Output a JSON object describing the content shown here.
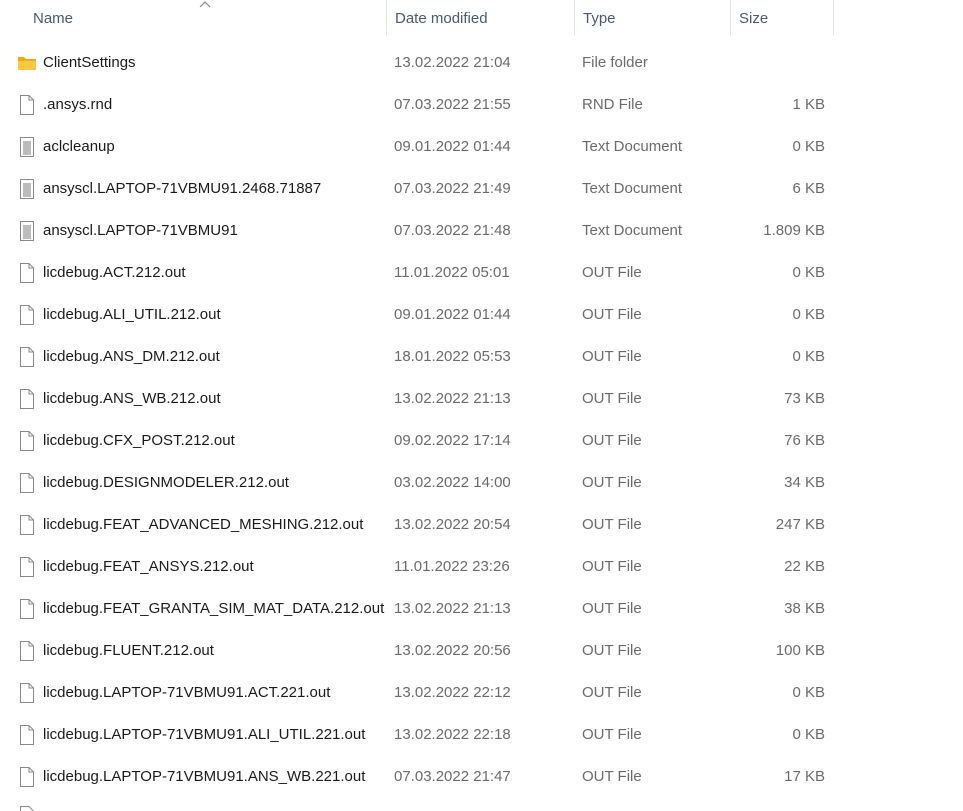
{
  "columns": {
    "name": "Name",
    "date": "Date modified",
    "type": "Type",
    "size": "Size"
  },
  "sort": {
    "column": "name",
    "icon": "sort-up-chevron-icon"
  },
  "files": [
    {
      "name": "ClientSettings",
      "date": "13.02.2022 21:04",
      "type": "File folder",
      "size": "",
      "icon": "folder"
    },
    {
      "name": ".ansys.rnd",
      "date": "07.03.2022 21:55",
      "type": "RND File",
      "size": "1 KB",
      "icon": "file"
    },
    {
      "name": "aclcleanup",
      "date": "09.01.2022 01:44",
      "type": "Text Document",
      "size": "0 KB",
      "icon": "text"
    },
    {
      "name": "ansyscl.LAPTOP-71VBMU91.2468.71887",
      "date": "07.03.2022 21:49",
      "type": "Text Document",
      "size": "6 KB",
      "icon": "text"
    },
    {
      "name": "ansyscl.LAPTOP-71VBMU91",
      "date": "07.03.2022 21:48",
      "type": "Text Document",
      "size": "1.809 KB",
      "icon": "text"
    },
    {
      "name": "licdebug.ACT.212.out",
      "date": "11.01.2022 05:01",
      "type": "OUT File",
      "size": "0 KB",
      "icon": "file"
    },
    {
      "name": "licdebug.ALI_UTIL.212.out",
      "date": "09.01.2022 01:44",
      "type": "OUT File",
      "size": "0 KB",
      "icon": "file"
    },
    {
      "name": "licdebug.ANS_DM.212.out",
      "date": "18.01.2022 05:53",
      "type": "OUT File",
      "size": "0 KB",
      "icon": "file"
    },
    {
      "name": "licdebug.ANS_WB.212.out",
      "date": "13.02.2022 21:13",
      "type": "OUT File",
      "size": "73 KB",
      "icon": "file"
    },
    {
      "name": "licdebug.CFX_POST.212.out",
      "date": "09.02.2022 17:14",
      "type": "OUT File",
      "size": "76 KB",
      "icon": "file"
    },
    {
      "name": "licdebug.DESIGNMODELER.212.out",
      "date": "03.02.2022 14:00",
      "type": "OUT File",
      "size": "34 KB",
      "icon": "file"
    },
    {
      "name": "licdebug.FEAT_ADVANCED_MESHING.212.out",
      "date": "13.02.2022 20:54",
      "type": "OUT File",
      "size": "247 KB",
      "icon": "file"
    },
    {
      "name": "licdebug.FEAT_ANSYS.212.out",
      "date": "11.01.2022 23:26",
      "type": "OUT File",
      "size": "22 KB",
      "icon": "file"
    },
    {
      "name": "licdebug.FEAT_GRANTA_SIM_MAT_DATA.212.out",
      "date": "13.02.2022 21:13",
      "type": "OUT File",
      "size": "38 KB",
      "icon": "file"
    },
    {
      "name": "licdebug.FLUENT.212.out",
      "date": "13.02.2022 20:56",
      "type": "OUT File",
      "size": "100 KB",
      "icon": "file"
    },
    {
      "name": "licdebug.LAPTOP-71VBMU91.ACT.221.out",
      "date": "13.02.2022 22:12",
      "type": "OUT File",
      "size": "0 KB",
      "icon": "file"
    },
    {
      "name": "licdebug.LAPTOP-71VBMU91.ALI_UTIL.221.out",
      "date": "13.02.2022 22:18",
      "type": "OUT File",
      "size": "0 KB",
      "icon": "file"
    },
    {
      "name": "licdebug.LAPTOP-71VBMU91.ANS_WB.221.out",
      "date": "07.03.2022 21:47",
      "type": "OUT File",
      "size": "17 KB",
      "icon": "file"
    }
  ],
  "colors": {
    "folder": "#f8c93f",
    "folder_dark": "#e9ad1c",
    "file_outline": "#8a8a8a",
    "text_lines": "#7a7a7a",
    "header_text": "#4a5a6e"
  }
}
